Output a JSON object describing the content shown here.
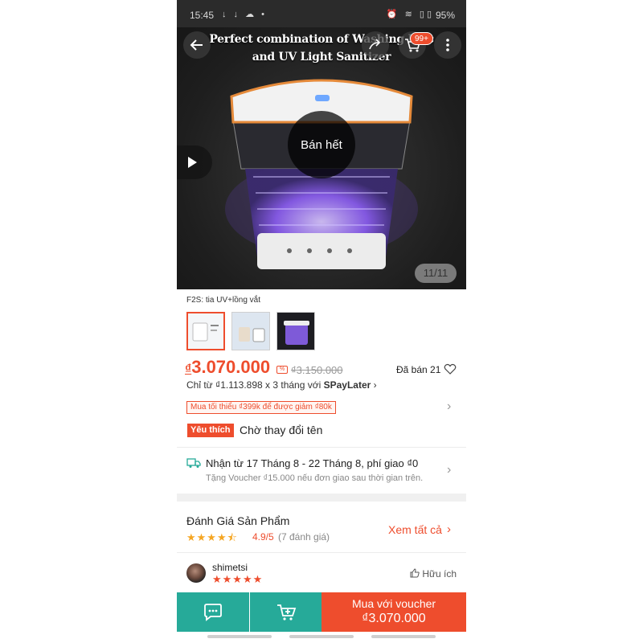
{
  "status_bar": {
    "time": "15:45",
    "icons_left": "↓ ↓ ☁ •",
    "icons_right": "⏰ ≋ ▯▯",
    "battery": "95%"
  },
  "hero": {
    "title_line1": "Perfect combination of Washing Mac",
    "title_line2": "and UV Light Sanitizer",
    "cart_badge": "99+",
    "sold_out": "Bán hết",
    "counter": "11/11"
  },
  "variation": {
    "label": "F2S: tia UV+lồng vắt"
  },
  "price": {
    "currency": "₫",
    "current": "3.070.000",
    "original": "₫3.150.000",
    "sold": "Đã bán 21",
    "installment_prefix": "Chỉ từ ₫1.113.898 x 3 tháng với ",
    "installment_brand": "SPayLater",
    "installment_chevron": "›",
    "voucher": "Mua tối thiểu ₫399k để được giảm ₫80k"
  },
  "product": {
    "badge": "Yêu thích",
    "name": "Chờ thay đổi tên"
  },
  "shipping": {
    "main": "Nhận từ 17 Tháng 8 - 22 Tháng 8, phí giao ₫0",
    "sub": "Tặng Voucher ₫15.000 nếu đơn giao sau thời gian trên."
  },
  "reviews": {
    "title": "Đánh Giá Sản Phẩm",
    "stars": "★★★★⯪",
    "rating": "4.9/5",
    "count": "(7 đánh giá)",
    "see_all": "Xem tất cả",
    "reviewer": "shimetsi",
    "reviewer_stars": "★★★★★",
    "helpful": "Hữu ích"
  },
  "bottom_bar": {
    "buy_label": "Mua với voucher",
    "buy_price": "₫3.070.000"
  },
  "colors": {
    "accent": "#ee4d2d",
    "teal": "#26aa99",
    "star": "#f5a623"
  },
  "icons": [
    "back-arrow-icon",
    "share-icon",
    "cart-icon",
    "more-icon",
    "play-icon",
    "heart-icon",
    "truck-icon",
    "thumbs-up-icon",
    "chat-icon",
    "add-to-cart-icon"
  ]
}
